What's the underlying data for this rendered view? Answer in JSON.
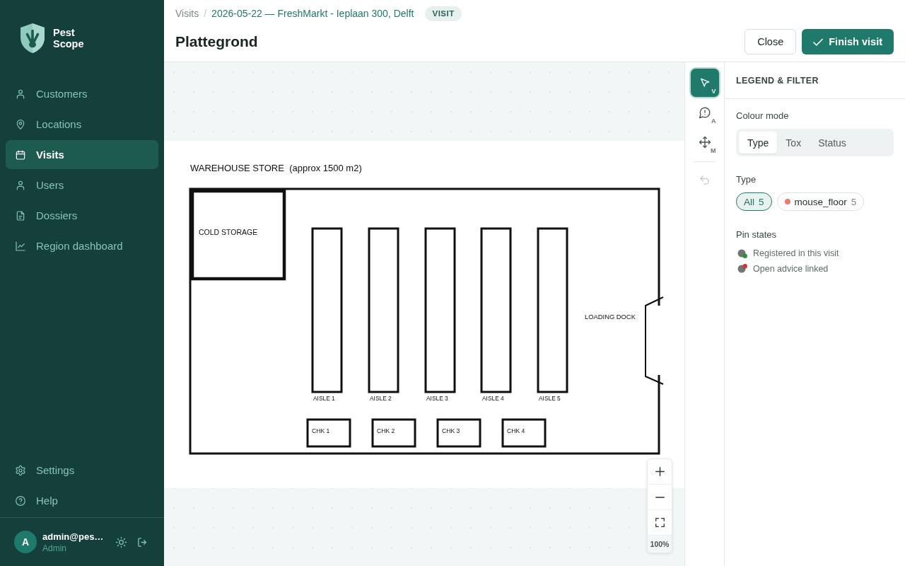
{
  "sidebar": {
    "brand": {
      "name": "Pest Scope"
    },
    "nav": [
      {
        "label": "Customers",
        "selected": false
      },
      {
        "label": "Locations",
        "selected": false
      },
      {
        "label": "Visits",
        "selected": true
      },
      {
        "label": "Users",
        "selected": false
      },
      {
        "label": "Dossiers",
        "selected": false
      },
      {
        "label": "Region dashboard",
        "selected": false
      }
    ],
    "footer_nav": [
      {
        "label": "Settings",
        "selected": false
      },
      {
        "label": "Help",
        "selected": false
      }
    ],
    "user": {
      "avatar_initial": "A",
      "email": "admin@pes…",
      "role": "Admin"
    }
  },
  "header": {
    "breadcrumb": [
      {
        "label": "Visits"
      },
      {
        "label": "2026-05-22 — FreshMarkt - Ieplaan 300, Delft"
      }
    ],
    "separator": "/",
    "badge": "VISIT",
    "title": "Plattegrond",
    "buttons": [
      {
        "kind": "secondary",
        "label": "Close"
      },
      {
        "kind": "primary",
        "label": "Finish visit"
      }
    ]
  },
  "floor_plan": {
    "title": "WAREHOUSE STORE  (approx 1500 m2)",
    "cold_storage": "COLD STORAGE",
    "aisles": [
      "AISLE 1",
      "AISLE 2",
      "AISLE 3",
      "AISLE 4",
      "AISLE 5"
    ],
    "checkouts": [
      "CHK 1",
      "CHK 2",
      "CHK 3",
      "CHK 4"
    ],
    "loading_dock": "LOADING DOCK"
  },
  "zoom_controls": {
    "reading": "100%"
  },
  "toolbar": {
    "tools": [
      {
        "kind": "select",
        "shortcut": "V",
        "selected": true
      },
      {
        "kind": "annotate",
        "shortcut": "A",
        "selected": false
      },
      {
        "kind": "move",
        "shortcut": "M",
        "selected": false
      }
    ],
    "undo": {
      "disabled": true
    }
  },
  "legend_panel": {
    "title": "LEGEND & FILTER",
    "colour_mode": {
      "label": "Colour mode",
      "options": [
        {
          "label": "Type",
          "selected": true
        },
        {
          "label": "Tox",
          "selected": false
        },
        {
          "label": "Status",
          "selected": false
        }
      ]
    },
    "type_filter": {
      "label": "Type",
      "chips": [
        {
          "label": "All",
          "count": "5",
          "selected": true
        },
        {
          "label": "mouse_floor",
          "count": "5",
          "selected": false,
          "color": "#f07a6c"
        }
      ]
    },
    "pin_states": {
      "label": "Pin states",
      "items": [
        {
          "kind": "registered",
          "label": "Registered in this visit",
          "color": "#2e8b3a"
        },
        {
          "kind": "advice",
          "label": "Open advice linked",
          "color": "#d93030"
        }
      ]
    }
  }
}
